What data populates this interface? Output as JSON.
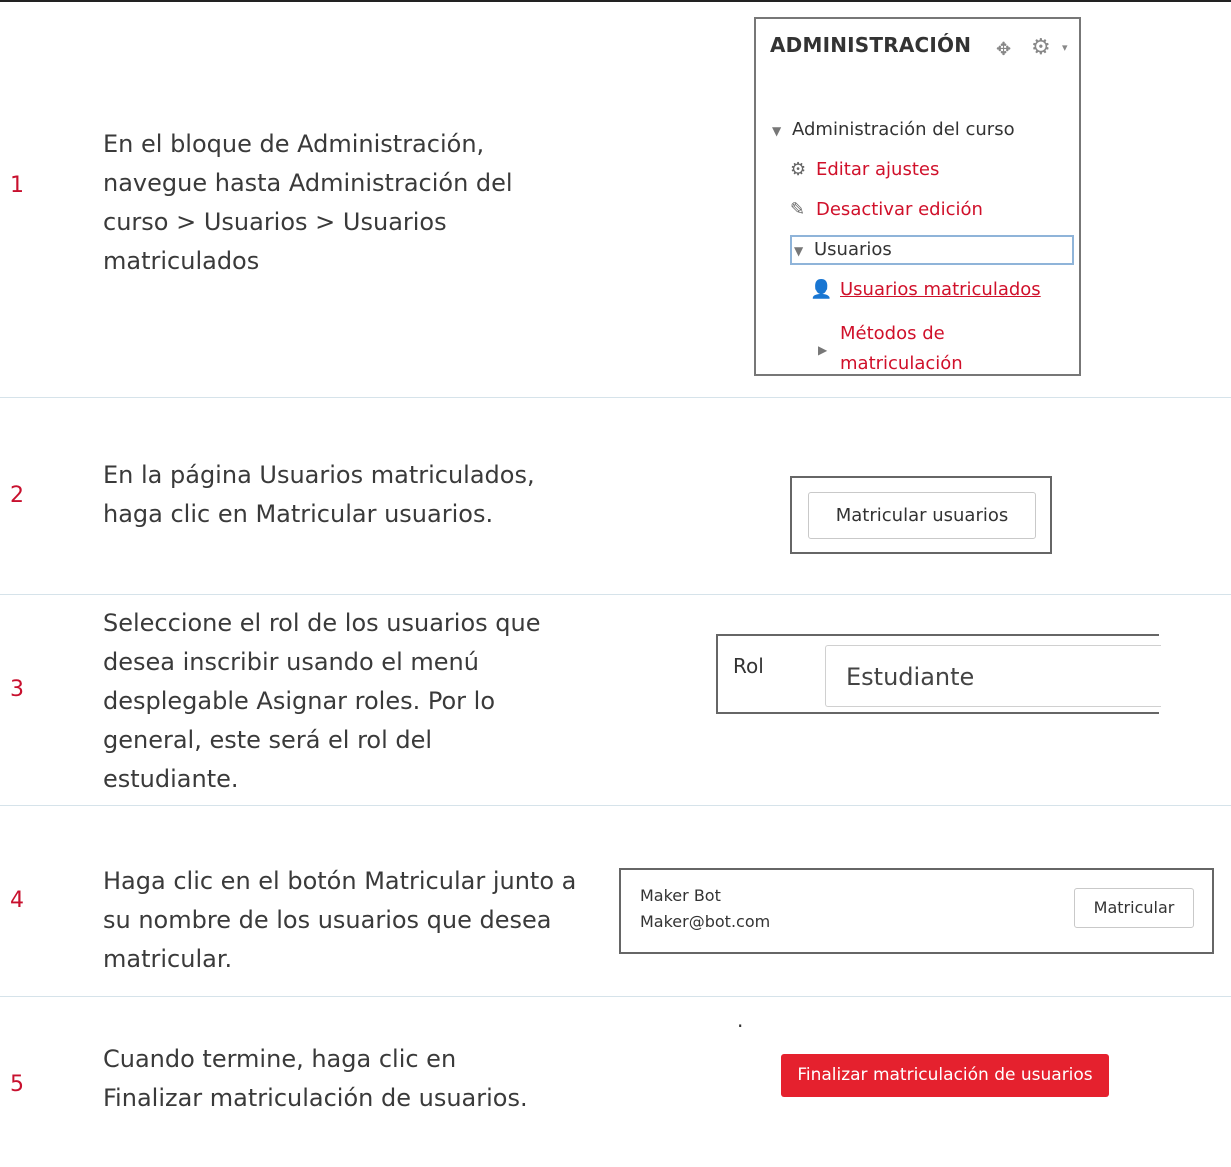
{
  "steps": [
    {
      "number": "1",
      "text": "En el bloque de Administración, navegue hasta Administración del curso > Usuarios > Usuarios matriculados"
    },
    {
      "number": "2",
      "text": "En la página Usuarios matriculados, haga clic en Matricular usuarios."
    },
    {
      "number": "3",
      "text": "Seleccione el rol de los usuarios que desea inscribir usando el menú desplegable Asignar roles. Por lo general, este será el rol del estudiante."
    },
    {
      "number": "4",
      "text": "Haga clic en el botón Matricular junto a su nombre de los usuarios que desea matricular."
    },
    {
      "number": "5",
      "text": "Cuando termine, haga clic en Finalizar matriculación de usuarios."
    }
  ],
  "admin_block": {
    "title": "ADMINISTRACIÓN",
    "course_admin": "Administración del curso",
    "edit_settings": "Editar ajustes",
    "turn_editing_off": "Desactivar edición",
    "users": "Usuarios",
    "enrolled_users": "Usuarios matriculados",
    "enrolment_methods_1": "Métodos de",
    "enrolment_methods_2": "matriculación"
  },
  "enrol_users_button": "Matricular usuarios",
  "role": {
    "label": "Rol",
    "value": "Estudiante"
  },
  "user_row": {
    "name": "Maker Bot",
    "email": "Maker@bot.com",
    "button": "Matricular"
  },
  "dot": ".",
  "finish_button": "Finalizar matriculación de usuarios",
  "colors": {
    "accent_red": "#d0102a",
    "button_red": "#e5212e",
    "divider": "#d6e3ea"
  }
}
